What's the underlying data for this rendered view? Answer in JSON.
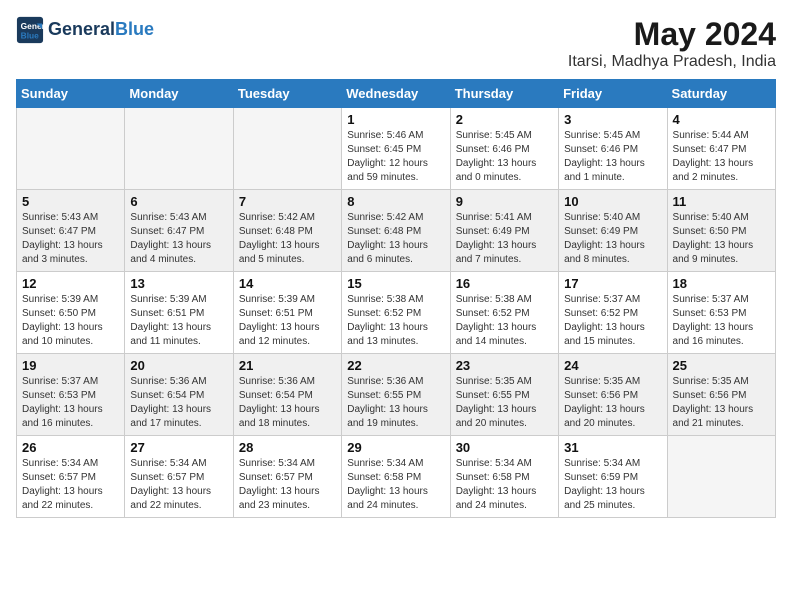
{
  "header": {
    "logo_line1": "General",
    "logo_line2": "Blue",
    "month_year": "May 2024",
    "location": "Itarsi, Madhya Pradesh, India"
  },
  "days_of_week": [
    "Sunday",
    "Monday",
    "Tuesday",
    "Wednesday",
    "Thursday",
    "Friday",
    "Saturday"
  ],
  "weeks": [
    [
      {
        "day": "",
        "info": "",
        "empty": true
      },
      {
        "day": "",
        "info": "",
        "empty": true
      },
      {
        "day": "",
        "info": "",
        "empty": true
      },
      {
        "day": "1",
        "info": "Sunrise: 5:46 AM\nSunset: 6:45 PM\nDaylight: 12 hours\nand 59 minutes."
      },
      {
        "day": "2",
        "info": "Sunrise: 5:45 AM\nSunset: 6:46 PM\nDaylight: 13 hours\nand 0 minutes."
      },
      {
        "day": "3",
        "info": "Sunrise: 5:45 AM\nSunset: 6:46 PM\nDaylight: 13 hours\nand 1 minute."
      },
      {
        "day": "4",
        "info": "Sunrise: 5:44 AM\nSunset: 6:47 PM\nDaylight: 13 hours\nand 2 minutes."
      }
    ],
    [
      {
        "day": "5",
        "info": "Sunrise: 5:43 AM\nSunset: 6:47 PM\nDaylight: 13 hours\nand 3 minutes.",
        "shaded": true
      },
      {
        "day": "6",
        "info": "Sunrise: 5:43 AM\nSunset: 6:47 PM\nDaylight: 13 hours\nand 4 minutes.",
        "shaded": true
      },
      {
        "day": "7",
        "info": "Sunrise: 5:42 AM\nSunset: 6:48 PM\nDaylight: 13 hours\nand 5 minutes.",
        "shaded": true
      },
      {
        "day": "8",
        "info": "Sunrise: 5:42 AM\nSunset: 6:48 PM\nDaylight: 13 hours\nand 6 minutes.",
        "shaded": true
      },
      {
        "day": "9",
        "info": "Sunrise: 5:41 AM\nSunset: 6:49 PM\nDaylight: 13 hours\nand 7 minutes.",
        "shaded": true
      },
      {
        "day": "10",
        "info": "Sunrise: 5:40 AM\nSunset: 6:49 PM\nDaylight: 13 hours\nand 8 minutes.",
        "shaded": true
      },
      {
        "day": "11",
        "info": "Sunrise: 5:40 AM\nSunset: 6:50 PM\nDaylight: 13 hours\nand 9 minutes.",
        "shaded": true
      }
    ],
    [
      {
        "day": "12",
        "info": "Sunrise: 5:39 AM\nSunset: 6:50 PM\nDaylight: 13 hours\nand 10 minutes."
      },
      {
        "day": "13",
        "info": "Sunrise: 5:39 AM\nSunset: 6:51 PM\nDaylight: 13 hours\nand 11 minutes."
      },
      {
        "day": "14",
        "info": "Sunrise: 5:39 AM\nSunset: 6:51 PM\nDaylight: 13 hours\nand 12 minutes."
      },
      {
        "day": "15",
        "info": "Sunrise: 5:38 AM\nSunset: 6:52 PM\nDaylight: 13 hours\nand 13 minutes."
      },
      {
        "day": "16",
        "info": "Sunrise: 5:38 AM\nSunset: 6:52 PM\nDaylight: 13 hours\nand 14 minutes."
      },
      {
        "day": "17",
        "info": "Sunrise: 5:37 AM\nSunset: 6:52 PM\nDaylight: 13 hours\nand 15 minutes."
      },
      {
        "day": "18",
        "info": "Sunrise: 5:37 AM\nSunset: 6:53 PM\nDaylight: 13 hours\nand 16 minutes."
      }
    ],
    [
      {
        "day": "19",
        "info": "Sunrise: 5:37 AM\nSunset: 6:53 PM\nDaylight: 13 hours\nand 16 minutes.",
        "shaded": true
      },
      {
        "day": "20",
        "info": "Sunrise: 5:36 AM\nSunset: 6:54 PM\nDaylight: 13 hours\nand 17 minutes.",
        "shaded": true
      },
      {
        "day": "21",
        "info": "Sunrise: 5:36 AM\nSunset: 6:54 PM\nDaylight: 13 hours\nand 18 minutes.",
        "shaded": true
      },
      {
        "day": "22",
        "info": "Sunrise: 5:36 AM\nSunset: 6:55 PM\nDaylight: 13 hours\nand 19 minutes.",
        "shaded": true
      },
      {
        "day": "23",
        "info": "Sunrise: 5:35 AM\nSunset: 6:55 PM\nDaylight: 13 hours\nand 20 minutes.",
        "shaded": true
      },
      {
        "day": "24",
        "info": "Sunrise: 5:35 AM\nSunset: 6:56 PM\nDaylight: 13 hours\nand 20 minutes.",
        "shaded": true
      },
      {
        "day": "25",
        "info": "Sunrise: 5:35 AM\nSunset: 6:56 PM\nDaylight: 13 hours\nand 21 minutes.",
        "shaded": true
      }
    ],
    [
      {
        "day": "26",
        "info": "Sunrise: 5:34 AM\nSunset: 6:57 PM\nDaylight: 13 hours\nand 22 minutes."
      },
      {
        "day": "27",
        "info": "Sunrise: 5:34 AM\nSunset: 6:57 PM\nDaylight: 13 hours\nand 22 minutes."
      },
      {
        "day": "28",
        "info": "Sunrise: 5:34 AM\nSunset: 6:57 PM\nDaylight: 13 hours\nand 23 minutes."
      },
      {
        "day": "29",
        "info": "Sunrise: 5:34 AM\nSunset: 6:58 PM\nDaylight: 13 hours\nand 24 minutes."
      },
      {
        "day": "30",
        "info": "Sunrise: 5:34 AM\nSunset: 6:58 PM\nDaylight: 13 hours\nand 24 minutes."
      },
      {
        "day": "31",
        "info": "Sunrise: 5:34 AM\nSunset: 6:59 PM\nDaylight: 13 hours\nand 25 minutes."
      },
      {
        "day": "",
        "info": "",
        "empty": true
      }
    ]
  ]
}
